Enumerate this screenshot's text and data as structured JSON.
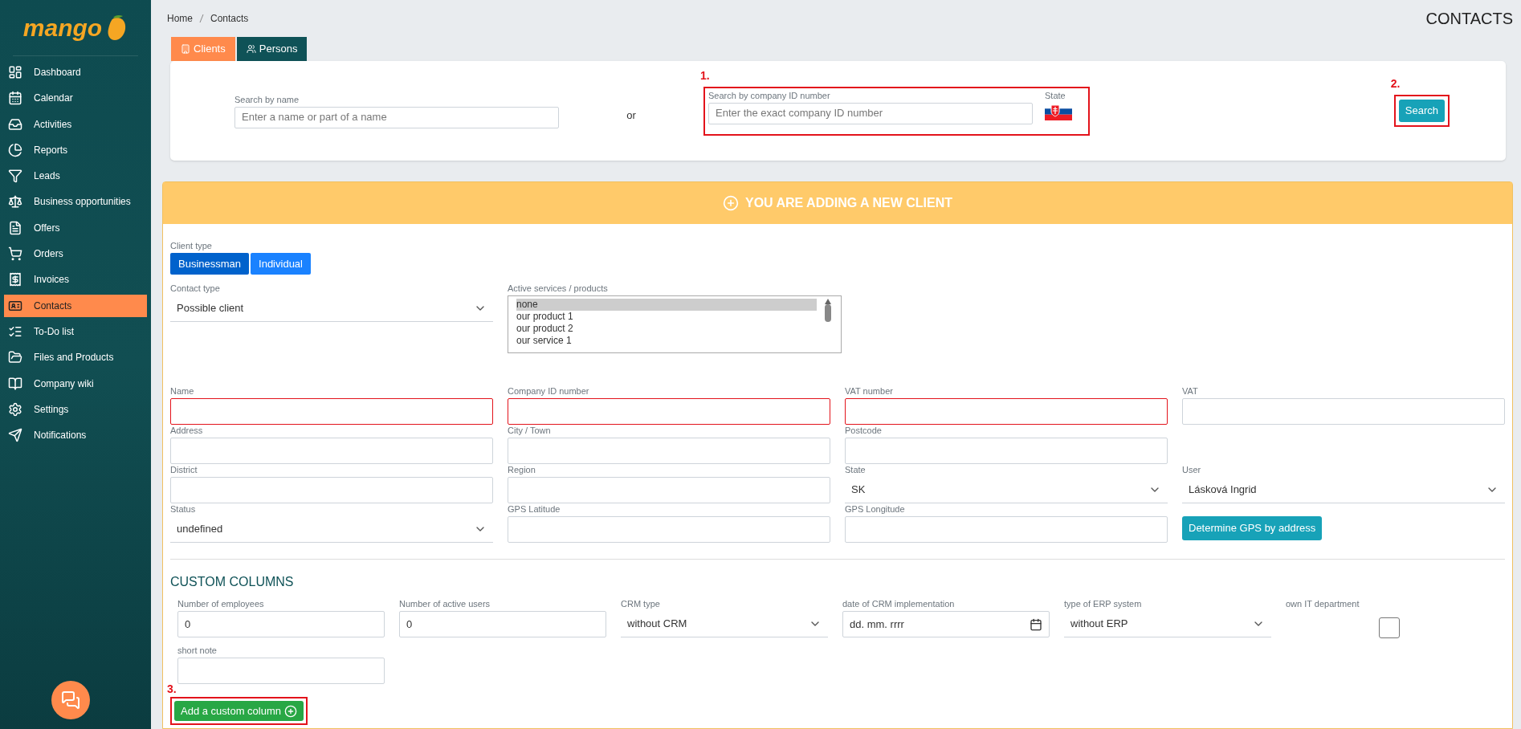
{
  "sidebar": {
    "logo": "mango",
    "items": [
      {
        "label": "Dashboard",
        "selected": false
      },
      {
        "label": "Calendar",
        "selected": false
      },
      {
        "label": "Activities",
        "selected": false
      },
      {
        "label": "Reports",
        "selected": false
      },
      {
        "label": "Leads",
        "selected": false
      },
      {
        "label": "Business opportunities",
        "selected": false
      },
      {
        "label": "Offers",
        "selected": false
      },
      {
        "label": "Orders",
        "selected": false
      },
      {
        "label": "Invoices",
        "selected": false
      },
      {
        "label": "Contacts",
        "selected": true
      },
      {
        "label": "To-Do list",
        "selected": false
      },
      {
        "label": "Files and Products",
        "selected": false
      },
      {
        "label": "Company wiki",
        "selected": false
      },
      {
        "label": "Settings",
        "selected": false
      },
      {
        "label": "Notifications",
        "selected": false
      }
    ]
  },
  "breadcrumb": [
    "Home",
    "Contacts"
  ],
  "page_title": "CONTACTS",
  "tabs": [
    {
      "label": "Clients",
      "selected": true
    },
    {
      "label": "Persons",
      "selected": false
    }
  ],
  "search": {
    "name_label": "Search by name",
    "name_placeholder": "Enter a name or part of a name",
    "or": "or",
    "id_annotation": "1.",
    "id_label": "Search by company ID number",
    "id_placeholder": "Enter the exact company ID number",
    "state_label": "State",
    "button_annotation": "2.",
    "button": "Search"
  },
  "new_client": {
    "title": "YOU ARE ADDING A NEW CLIENT",
    "client_type": {
      "label": "Client type",
      "options": [
        {
          "label": "Businessman",
          "selected": true
        },
        {
          "label": "Individual",
          "selected": false
        }
      ]
    },
    "contact_type": {
      "label": "Contact type",
      "value": "Possible client"
    },
    "services": {
      "label": "Active services / products",
      "options": [
        {
          "label": "none",
          "selected": true
        },
        {
          "label": "our product 1",
          "selected": false
        },
        {
          "label": "our product 2",
          "selected": false
        },
        {
          "label": "our service 1",
          "selected": false
        }
      ]
    },
    "rows": [
      [
        {
          "kind": "text",
          "label": "Name",
          "required": true
        },
        {
          "kind": "text",
          "label": "Company ID number",
          "required": true
        },
        {
          "kind": "text",
          "label": "VAT number",
          "required": true
        },
        {
          "kind": "text",
          "label": "VAT",
          "required": false
        }
      ],
      [
        {
          "kind": "text",
          "label": "Address",
          "required": false
        },
        {
          "kind": "text",
          "label": "City / Town",
          "required": false
        },
        {
          "kind": "text",
          "label": "Postcode",
          "required": false
        }
      ],
      [
        {
          "kind": "text",
          "label": "District",
          "required": false
        },
        {
          "kind": "text",
          "label": "Region",
          "required": false
        },
        {
          "kind": "select",
          "label": "State",
          "value": "SK"
        },
        {
          "kind": "select",
          "label": "User",
          "value": "Lásková Ingrid"
        }
      ],
      [
        {
          "kind": "select",
          "label": "Status",
          "value": "undefined"
        },
        {
          "kind": "text",
          "label": "GPS Latitude",
          "required": false
        },
        {
          "kind": "text",
          "label": "GPS Longitude",
          "required": false
        },
        {
          "kind": "button",
          "label": "Determine GPS by address"
        }
      ]
    ],
    "custom_title": "CUSTOM COLUMNS",
    "custom_rows": [
      [
        {
          "kind": "text",
          "label": "Number of employees",
          "value": "0"
        },
        {
          "kind": "text",
          "label": "Number of active users",
          "value": "0"
        },
        {
          "kind": "select",
          "label": "CRM type",
          "value": "without CRM"
        },
        {
          "kind": "date",
          "label": "date of CRM implementation",
          "value": "dd. mm. rrrr"
        },
        {
          "kind": "select",
          "label": "type of ERP system",
          "value": "without ERP"
        },
        {
          "kind": "checkbox",
          "label": "own IT department",
          "checked": false
        }
      ],
      [
        {
          "kind": "text",
          "label": "short note"
        }
      ]
    ],
    "add_annotation": "3.",
    "add_button": "Add a custom column"
  }
}
